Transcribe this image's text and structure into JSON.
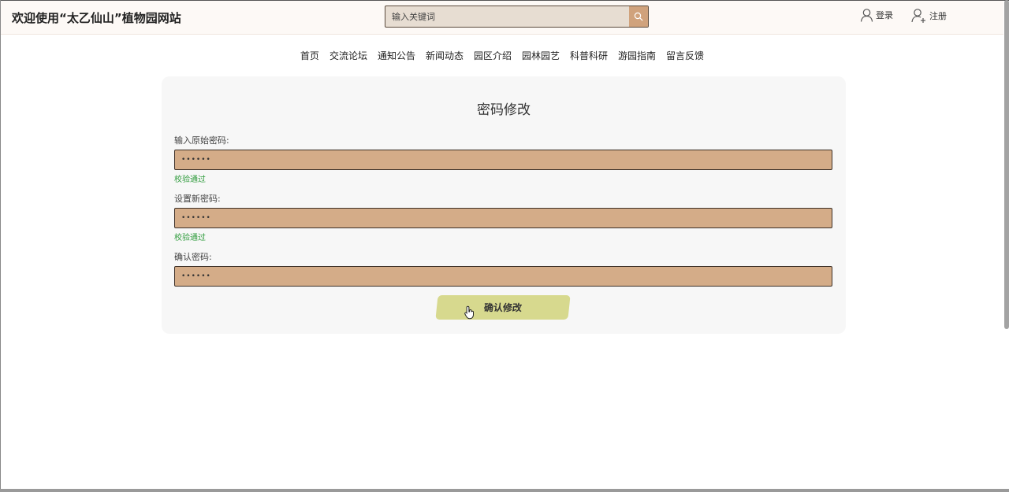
{
  "header": {
    "site_title": "欢迎使用“太乙仙山”植物园网站",
    "search": {
      "placeholder": "输入关键词"
    },
    "login_label": "登录",
    "register_label": "注册"
  },
  "nav": {
    "items": [
      {
        "label": "首页"
      },
      {
        "label": "交流论坛"
      },
      {
        "label": "通知公告"
      },
      {
        "label": "新闻动态"
      },
      {
        "label": "园区介绍"
      },
      {
        "label": "园林园艺"
      },
      {
        "label": "科普科研"
      },
      {
        "label": "游园指南"
      },
      {
        "label": "留言反馈"
      }
    ]
  },
  "form": {
    "title": "密码修改",
    "fields": [
      {
        "label": "输入原始密码:",
        "value": "••••••",
        "status": "校验通过"
      },
      {
        "label": "设置新密码:",
        "value": "••••••",
        "status": "校验通过"
      },
      {
        "label": "确认密码:",
        "value": "••••••"
      }
    ],
    "submit_label": "确认修改"
  },
  "colors": {
    "accent": "#d0a27c",
    "input_bg": "#d4ac88",
    "button_bg": "#d7d98e",
    "valid_text": "#2e9b3b"
  },
  "icons": {
    "search": "search-icon",
    "login": "user-icon",
    "register": "user-add-icon",
    "cursor": "hand-pointer-cursor-icon"
  }
}
